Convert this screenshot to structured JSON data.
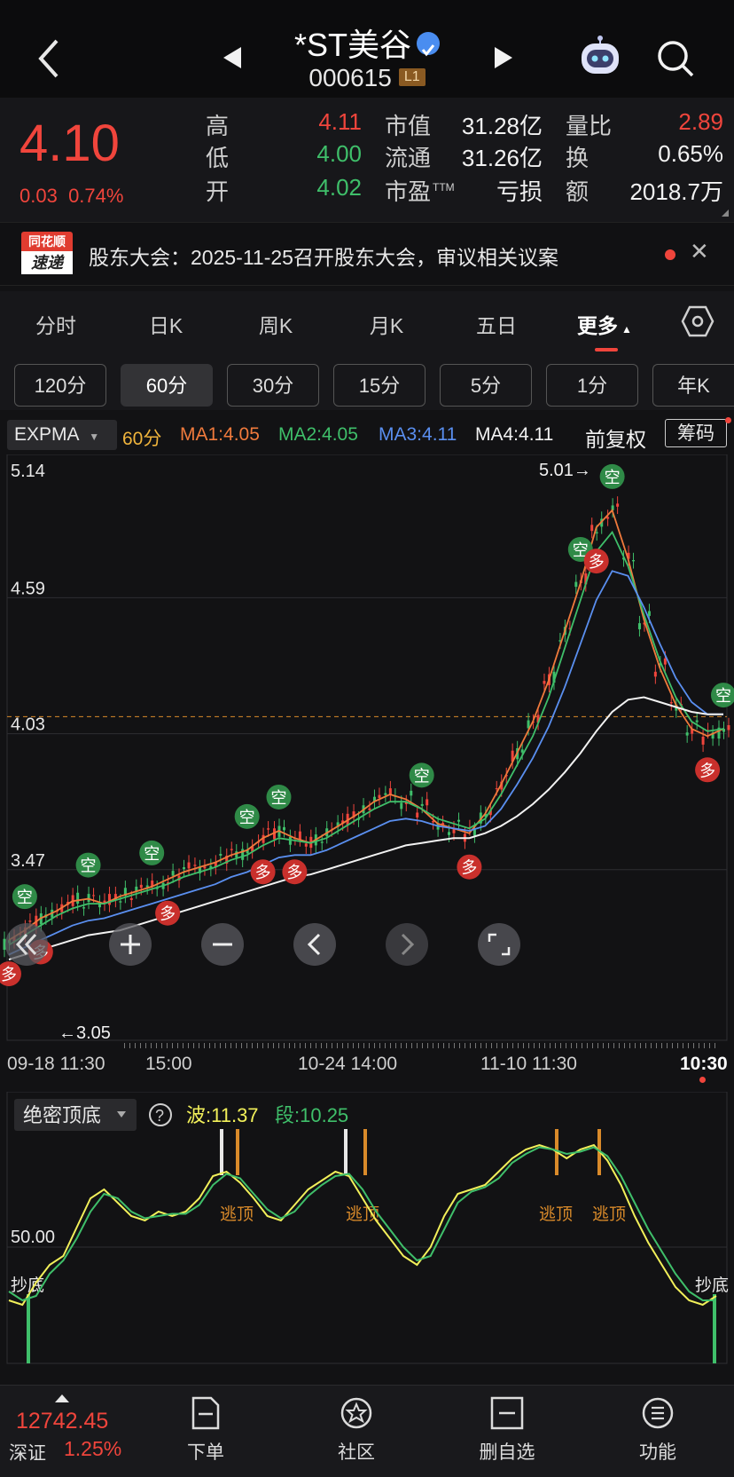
{
  "header": {
    "stock_name": "*ST美谷",
    "stock_code": "000615",
    "level_badge": "L1"
  },
  "quote": {
    "price": "4.10",
    "change_abs": "0.03",
    "change_pct": "0.74%",
    "labels": {
      "high": "高",
      "low": "低",
      "open": "开",
      "market_cap": "市值",
      "float_cap": "流通",
      "pe": "市盈",
      "pe_sup": "TTM",
      "volume_ratio": "量比",
      "turnover": "换",
      "amount": "额"
    },
    "values": {
      "high": "4.11",
      "low": "4.00",
      "open": "4.02",
      "market_cap": "31.28亿",
      "float_cap": "31.26亿",
      "pe": "亏损",
      "volume_ratio": "2.89",
      "turnover": "0.65%",
      "amount": "2018.7万"
    }
  },
  "news": {
    "logo_top": "同花顺",
    "logo_bottom": "速递",
    "text": "股东大会：2025-11-25召开股东大会，审议相关议案"
  },
  "tabs": [
    "分时",
    "日K",
    "周K",
    "月K",
    "五日",
    "更多"
  ],
  "periods": [
    "120分",
    "60分",
    "30分",
    "15分",
    "5分",
    "1分",
    "年K"
  ],
  "indicator": {
    "name": "EXPMA",
    "period": "60分",
    "ma1": "MA1:4.05",
    "ma2": "MA2:4.05",
    "ma3": "MA3:4.11",
    "ma4": "MA4:4.11",
    "adjust": "前复权",
    "chip_button": "筹码"
  },
  "colors": {
    "up": "#f0453c",
    "down": "#3fbf6a",
    "ma1": "#f07a3c",
    "ma2": "#3fbf6a",
    "ma3": "#5a8ff0",
    "ma4": "#f2f2f2",
    "wave": "#f2f05a",
    "segment": "#3fbf6a",
    "orange": "#d98a2a"
  },
  "chart_data": [
    {
      "type": "candlestick",
      "title": "",
      "y_ticks": [
        "5.14",
        "4.59",
        "4.03",
        "3.47"
      ],
      "ylim": [
        2.95,
        5.18
      ],
      "x_ticks": [
        "09-18 11:30",
        "15:00",
        "10-24 14:00",
        "11-10 11:30",
        "10:30"
      ],
      "high_label": "5.01",
      "low_label": "3.05",
      "current_price_line": 4.1,
      "series": [
        {
          "name": "MA1",
          "values": [
            3.18,
            3.22,
            3.27,
            3.3,
            3.34,
            3.35,
            3.33,
            3.36,
            3.38,
            3.4,
            3.43,
            3.46,
            3.48,
            3.5,
            3.53,
            3.55,
            3.6,
            3.63,
            3.6,
            3.58,
            3.62,
            3.66,
            3.7,
            3.75,
            3.78,
            3.76,
            3.72,
            3.66,
            3.64,
            3.62,
            3.7,
            3.82,
            3.95,
            4.08,
            4.25,
            4.45,
            4.65,
            4.88,
            4.95,
            4.75,
            4.5,
            4.3,
            4.15,
            4.05,
            4.02,
            4.05
          ]
        },
        {
          "name": "MA2",
          "values": [
            3.16,
            3.2,
            3.24,
            3.28,
            3.31,
            3.33,
            3.33,
            3.35,
            3.37,
            3.39,
            3.41,
            3.44,
            3.46,
            3.48,
            3.51,
            3.53,
            3.57,
            3.6,
            3.59,
            3.58,
            3.6,
            3.64,
            3.68,
            3.72,
            3.75,
            3.75,
            3.72,
            3.68,
            3.66,
            3.64,
            3.68,
            3.78,
            3.9,
            4.02,
            4.18,
            4.38,
            4.58,
            4.78,
            4.86,
            4.72,
            4.52,
            4.33,
            4.18,
            4.08,
            4.04,
            4.05
          ]
        },
        {
          "name": "MA3",
          "values": [
            3.12,
            3.15,
            3.18,
            3.21,
            3.24,
            3.26,
            3.27,
            3.29,
            3.31,
            3.33,
            3.35,
            3.37,
            3.39,
            3.41,
            3.44,
            3.46,
            3.49,
            3.52,
            3.53,
            3.53,
            3.55,
            3.58,
            3.61,
            3.64,
            3.67,
            3.68,
            3.67,
            3.65,
            3.64,
            3.63,
            3.65,
            3.72,
            3.82,
            3.93,
            4.06,
            4.22,
            4.4,
            4.58,
            4.7,
            4.68,
            4.55,
            4.4,
            4.26,
            4.16,
            4.11,
            4.11
          ]
        },
        {
          "name": "MA4",
          "values": [
            3.1,
            3.12,
            3.14,
            3.16,
            3.18,
            3.2,
            3.21,
            3.22,
            3.24,
            3.26,
            3.28,
            3.3,
            3.32,
            3.34,
            3.36,
            3.38,
            3.4,
            3.42,
            3.44,
            3.45,
            3.47,
            3.49,
            3.51,
            3.53,
            3.55,
            3.57,
            3.58,
            3.59,
            3.6,
            3.6,
            3.62,
            3.65,
            3.69,
            3.74,
            3.8,
            3.87,
            3.95,
            4.04,
            4.12,
            4.17,
            4.18,
            4.16,
            4.14,
            4.12,
            4.11,
            4.11
          ]
        }
      ],
      "signals_buy": "多",
      "signals_sell": "空"
    },
    {
      "type": "line",
      "title": "",
      "indicator_name": "绝密顶底",
      "wave_label": "波:11.37",
      "segment_label": "段:10.25",
      "y_tick": "50.00",
      "top_signal": "逃顶",
      "bottom_signal": "抄底",
      "series": [
        {
          "name": "波",
          "values": [
            22,
            20,
            30,
            38,
            42,
            55,
            68,
            72,
            66,
            60,
            58,
            62,
            60,
            62,
            68,
            78,
            80,
            75,
            68,
            60,
            58,
            65,
            72,
            76,
            80,
            78,
            68,
            58,
            50,
            42,
            38,
            46,
            60,
            70,
            72,
            74,
            80,
            86,
            90,
            92,
            90,
            86,
            90,
            92,
            85,
            74,
            60,
            48,
            38,
            28,
            22,
            20,
            24
          ]
        },
        {
          "name": "段",
          "values": [
            26,
            22,
            24,
            34,
            40,
            50,
            62,
            70,
            68,
            62,
            59,
            60,
            61,
            61,
            65,
            74,
            79,
            77,
            70,
            63,
            59,
            62,
            69,
            74,
            78,
            79,
            72,
            62,
            54,
            46,
            40,
            42,
            54,
            66,
            71,
            73,
            77,
            84,
            88,
            91,
            90,
            88,
            89,
            91,
            87,
            78,
            66,
            54,
            44,
            34,
            26,
            22,
            22
          ]
        }
      ]
    }
  ],
  "chart_controls": [
    "collapse-left",
    "zoom-in",
    "zoom-out",
    "pan-left",
    "pan-right",
    "fullscreen"
  ],
  "bottom_nav": {
    "index_value": "12742.45",
    "index_name": "深证",
    "index_change": "1.25%",
    "items": [
      "下单",
      "社区",
      "删自选",
      "功能"
    ]
  }
}
